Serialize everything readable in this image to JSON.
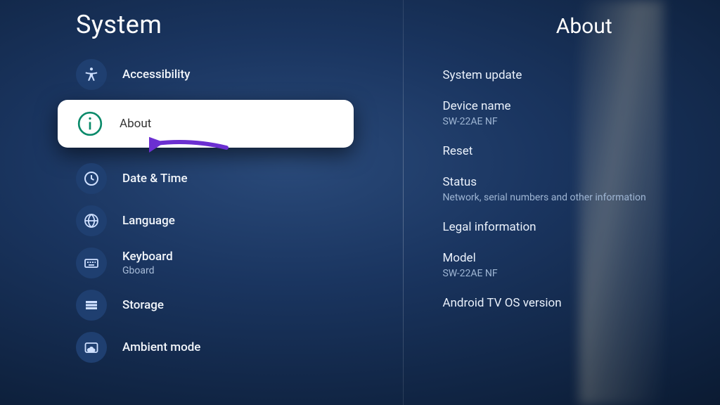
{
  "left": {
    "title": "System",
    "items": [
      {
        "label": "Accessibility"
      },
      {
        "label": "About"
      },
      {
        "label": "Date & Time"
      },
      {
        "label": "Language"
      },
      {
        "label": "Keyboard",
        "sublabel": "Gboard"
      },
      {
        "label": "Storage"
      },
      {
        "label": "Ambient mode"
      }
    ]
  },
  "right": {
    "title": "About",
    "items": [
      {
        "label": "System update"
      },
      {
        "label": "Device name",
        "sublabel": "SW-22AE NF"
      },
      {
        "label": "Reset"
      },
      {
        "label": "Status",
        "sublabel": "Network, serial numbers and other information"
      },
      {
        "label": "Legal information"
      },
      {
        "label": "Model",
        "sublabel": "SW-22AE NF"
      },
      {
        "label": "Android TV OS version"
      }
    ]
  },
  "colors": {
    "arrow": "#6b2fd1"
  }
}
